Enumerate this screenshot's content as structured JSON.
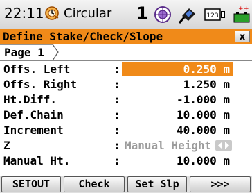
{
  "status": {
    "time": "22:11",
    "mode": "Circular",
    "face_indicator": "1",
    "icons": [
      "clock-icon",
      "target-icon",
      "prism-icon",
      "keyboard-123-icon",
      "battery-icon"
    ],
    "keyboard_text": "123"
  },
  "dialog": {
    "title": "Define Stake/Check/Slope",
    "close_label": "x"
  },
  "tab": {
    "label": "Page 1"
  },
  "fields": [
    {
      "label": "Offs. Left",
      "value": "0.250 m"
    },
    {
      "label": "Offs. Right",
      "value": "1.250 m"
    },
    {
      "label": "Ht.Diff.",
      "value": "-1.000 m"
    },
    {
      "label": "Def.Chain",
      "value": "10.000 m"
    },
    {
      "label": "Increment",
      "value": "40.000 m"
    },
    {
      "label": "Z",
      "value": "Manual Height"
    },
    {
      "label": "Manual Ht.",
      "value": "10.000 m"
    }
  ],
  "softkeys": [
    "SETOUT",
    "Check",
    "Set Slp",
    ">>>"
  ],
  "colors": {
    "accent": "#f08a19",
    "background": "#ffffff",
    "disabled_text": "#9c9c9c"
  }
}
